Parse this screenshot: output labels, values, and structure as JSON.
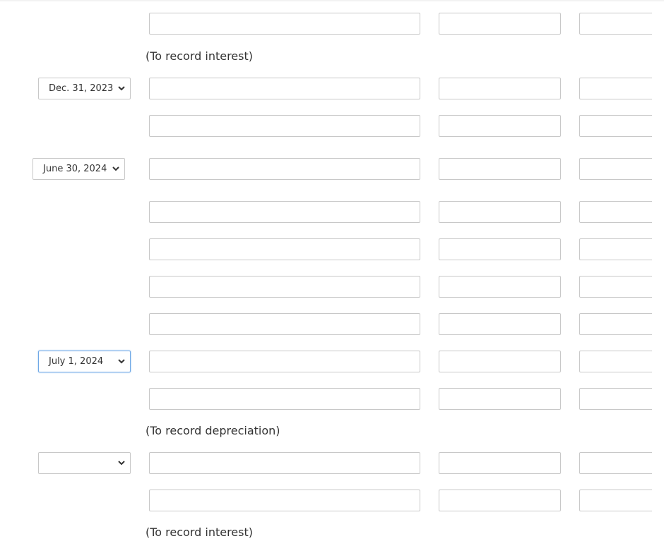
{
  "notes": {
    "n1": "(To record interest)",
    "n2": "(To record depreciation)",
    "n3": "(To record interest)"
  },
  "dates": {
    "d1": "Dec. 31, 2023",
    "d2": "June 30, 2024",
    "d3": "July 1, 2024",
    "d4": ""
  }
}
